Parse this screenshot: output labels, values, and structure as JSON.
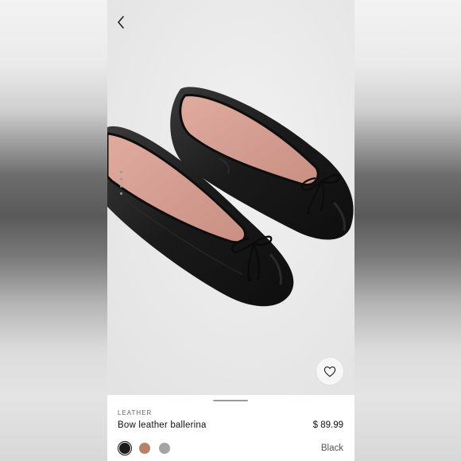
{
  "product": {
    "category": "LEATHER",
    "name": "Bow leather ballerina",
    "price": "$ 89.99",
    "selected_color": "Black"
  },
  "swatches": [
    {
      "name": "black",
      "color": "#1c1c1c",
      "selected": true
    },
    {
      "name": "tan",
      "color": "#b8826a",
      "selected": false
    },
    {
      "name": "grey",
      "color": "#a3a3a3",
      "selected": false
    }
  ],
  "icons": {
    "back": "chevron-left-icon",
    "favorite": "heart-icon"
  },
  "colors": {
    "image_background": "#ededed",
    "shoe": "#1e1e1e",
    "lining": "#d9a49a",
    "sheet": "#ffffff"
  }
}
